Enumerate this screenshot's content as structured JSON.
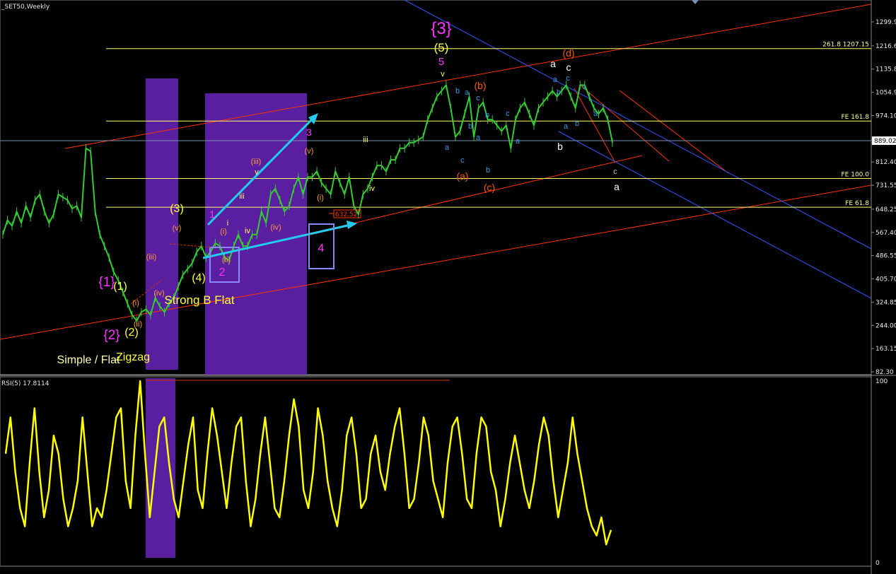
{
  "chart_title": "_SET50,Weekly",
  "rsi_title": "RSI(5) 17.8114",
  "colors": {
    "background": "#000000",
    "price": "#33cc33",
    "rsi": "#ffff00",
    "channel": "#ff3300",
    "down_channel": "#3355ff",
    "fib": "#ffff66",
    "box_fill": "#5a1fa0",
    "arrow": "#22ccee"
  },
  "chart_data": [
    {
      "type": "line",
      "title": "_SET50,Weekly",
      "ylim": [
        82.3,
        1350
      ],
      "y_ticks": [
        "1299.95",
        "1216.65",
        "1135.80",
        "1054.95",
        "974.10",
        "889.02",
        "812.40",
        "731.55",
        "648.25",
        "567.40",
        "486.55",
        "405.70",
        "324.85",
        "244.00",
        "163.15",
        "82.30"
      ],
      "series": [
        {
          "values": [
            560,
            610,
            590,
            640,
            600,
            660,
            620,
            680,
            700,
            640,
            600,
            630,
            700,
            690,
            680,
            650,
            660,
            620,
            860,
            850,
            640,
            560,
            520,
            480,
            430,
            400,
            360,
            320,
            280,
            260,
            290,
            300,
            280,
            340,
            310,
            290,
            320,
            340,
            380,
            420,
            440,
            460,
            500,
            520,
            480,
            500,
            530,
            520,
            480,
            470,
            520,
            560,
            520,
            520,
            560,
            560,
            640,
            600,
            700,
            720,
            680,
            640,
            660,
            720,
            760,
            700,
            760,
            760,
            780,
            740,
            720,
            700,
            780,
            740,
            700,
            760,
            660,
            630,
            700,
            720,
            760,
            800,
            800,
            780,
            820,
            820,
            860,
            860,
            880,
            880,
            890,
            900,
            960,
            1000,
            1040,
            1060,
            1080,
            1000,
            900,
            920,
            980,
            1040,
            900,
            1000,
            1020,
            960,
            960,
            940,
            920,
            940,
            860,
            960,
            1000,
            1020,
            980,
            940,
            1000,
            1020,
            1040,
            1060,
            1040,
            1060,
            1080,
            1040,
            1000,
            1080,
            1080,
            1040,
            1000,
            980,
            1000,
            960,
            880
          ]
        }
      ],
      "levels": [
        {
          "label": "261.8 1207.15",
          "value": 1207.15
        },
        {
          "label": "FE 161.8",
          "value": 955
        },
        {
          "label": "FE 100.0",
          "value": 755
        },
        {
          "label": "FE 61.8",
          "value": 655
        }
      ],
      "current_price": "889.02",
      "price_tag": "632.52"
    },
    {
      "type": "line",
      "title": "RSI(5) 17.8114",
      "ylim": [
        0,
        100
      ],
      "y_ticks": [
        "100",
        "0"
      ],
      "series": [
        {
          "values": [
            60,
            80,
            50,
            30,
            20,
            55,
            85,
            50,
            25,
            40,
            70,
            60,
            35,
            20,
            30,
            45,
            80,
            50,
            20,
            30,
            25,
            40,
            60,
            80,
            85,
            45,
            30,
            70,
            100,
            60,
            25,
            50,
            75,
            80,
            55,
            35,
            25,
            45,
            65,
            80,
            40,
            30,
            60,
            85,
            70,
            50,
            30,
            55,
            75,
            80,
            45,
            20,
            35,
            60,
            80,
            55,
            30,
            25,
            45,
            70,
            90,
            75,
            40,
            30,
            50,
            85,
            70,
            45,
            30,
            20,
            40,
            70,
            80,
            60,
            30,
            35,
            60,
            70,
            50,
            40,
            60,
            75,
            85,
            60,
            30,
            35,
            55,
            80,
            70,
            45,
            35,
            25,
            55,
            75,
            80,
            60,
            35,
            30,
            60,
            80,
            75,
            50,
            40,
            20,
            35,
            55,
            70,
            55,
            40,
            30,
            45,
            65,
            80,
            70,
            45,
            25,
            40,
            55,
            80,
            60,
            45,
            30,
            20,
            15,
            25,
            10,
            18
          ]
        }
      ]
    }
  ],
  "annotations": [
    {
      "text": "{3}",
      "color": "#ff33ff"
    },
    {
      "text": "(5)",
      "color": "#ffff33"
    },
    {
      "text": "5",
      "color": "#ff33ff"
    },
    {
      "text": "v",
      "color": "#ffff66"
    },
    {
      "text": "{1}",
      "color": "#ff33ff"
    },
    {
      "text": "(1)",
      "color": "#ffff33"
    },
    {
      "text": "{2}",
      "color": "#ff33ff"
    },
    {
      "text": "(2)",
      "color": "#ffff33"
    },
    {
      "text": "(3)",
      "color": "#ffff33"
    },
    {
      "text": "(4)",
      "color": "#ffff33"
    },
    {
      "text": "(i)",
      "color": "#ff9933"
    },
    {
      "text": "(ii)",
      "color": "#ff9933"
    },
    {
      "text": "(iii)",
      "color": "#ff9933"
    },
    {
      "text": "(iv)",
      "color": "#ff9933"
    },
    {
      "text": "(v)",
      "color": "#ff9933"
    },
    {
      "text": "(i)",
      "color": "#ff9933"
    },
    {
      "text": "(ii)",
      "color": "#ff9933"
    },
    {
      "text": "(iii)",
      "color": "#ff9933"
    },
    {
      "text": "(iv)",
      "color": "#ff9933"
    },
    {
      "text": "(v)",
      "color": "#ff9933"
    },
    {
      "text": "(i)",
      "color": "#ff9933"
    },
    {
      "text": "i",
      "color": "#ffff66"
    },
    {
      "text": "iii",
      "color": "#ffff66"
    },
    {
      "text": "iv",
      "color": "#ffff66"
    },
    {
      "text": "v",
      "color": "#ffff66"
    },
    {
      "text": "iii",
      "color": "#ffff66"
    },
    {
      "text": "iv",
      "color": "#ffff66"
    },
    {
      "text": "1",
      "color": "#ff33ff"
    },
    {
      "text": "2",
      "color": "#ff33ff"
    },
    {
      "text": "3",
      "color": "#ff33ff"
    },
    {
      "text": "4",
      "color": "#ff33ff"
    },
    {
      "text": "Strong B Flat",
      "color": "#ffff33"
    },
    {
      "text": "Simple / Flat",
      "color": "#ffffaa"
    },
    {
      "text": "Zigzag",
      "color": "#ffff33"
    },
    {
      "text": "(a)",
      "color": "#ff5500"
    },
    {
      "text": "(b)",
      "color": "#ff5500"
    },
    {
      "text": "(c)",
      "color": "#ff5500"
    },
    {
      "text": "(d)",
      "color": "#ff5500"
    },
    {
      "text": "a",
      "color": "#3399dd"
    },
    {
      "text": "b",
      "color": "#3399dd"
    },
    {
      "text": "a",
      "color": "#3399dd"
    },
    {
      "text": "b",
      "color": "#3399dd"
    },
    {
      "text": "c",
      "color": "#3399dd"
    },
    {
      "text": "c",
      "color": "#3399dd"
    },
    {
      "text": "a",
      "color": "#3399dd"
    },
    {
      "text": "b",
      "color": "#3399dd"
    },
    {
      "text": "b",
      "color": "#3399dd"
    },
    {
      "text": "c",
      "color": "#3399dd"
    },
    {
      "text": "a",
      "color": "#3399dd"
    },
    {
      "text": "b",
      "color": "#3399dd"
    },
    {
      "text": "a",
      "color": "#3399dd"
    },
    {
      "text": "c",
      "color": "#3399dd"
    },
    {
      "text": "c",
      "color": "#3399dd"
    },
    {
      "text": "a",
      "color": "#3399dd"
    },
    {
      "text": "b",
      "color": "#3399dd"
    },
    {
      "text": "a",
      "color": "#3399dd"
    },
    {
      "text": "a",
      "color": "#ffffff"
    },
    {
      "text": "c",
      "color": "#ffffff"
    },
    {
      "text": "b",
      "color": "#ffffff"
    },
    {
      "text": "a",
      "color": "#ffffff"
    },
    {
      "text": "c",
      "color": "#bbbbbb"
    }
  ]
}
